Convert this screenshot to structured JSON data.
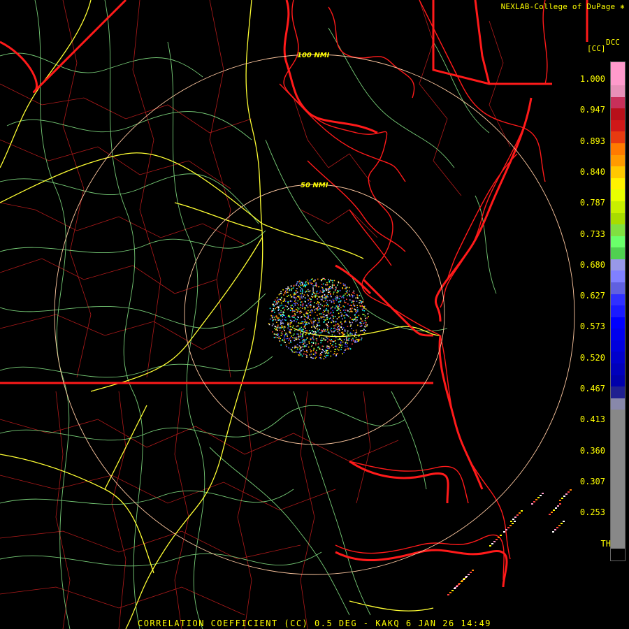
{
  "credit": "NEXLAB-College of DuPage",
  "caption": "CORRELATION COEFFICIENT (CC) 0.5 DEG - KAKQ 6 JAN 26 14:49",
  "legend": {
    "product": "DCC",
    "unit": "[CC]",
    "ticks": [
      "1.000",
      "0.947",
      "0.893",
      "0.840",
      "0.787",
      "0.733",
      "0.680",
      "0.627",
      "0.573",
      "0.520",
      "0.467",
      "0.413",
      "0.360",
      "0.307",
      "0.253",
      "TH"
    ],
    "colors": [
      "#ff9acb",
      "#ff9acb",
      "#e890b8",
      "#c8305a",
      "#b8101a",
      "#d01818",
      "#e83a10",
      "#ff7a00",
      "#ff9a00",
      "#ffc800",
      "#fff200",
      "#e8ff00",
      "#c8f000",
      "#a8dc00",
      "#80e040",
      "#6aff6a",
      "#50d050",
      "#9898e8",
      "#8080ff",
      "#6060e0",
      "#3030ff",
      "#1a1aff",
      "#0000ff",
      "#0000ee",
      "#0000dd",
      "#0000cc",
      "#0000bb",
      "#0000aa",
      "#202090",
      "#8888aa",
      "#888888",
      "#888888",
      "#888888",
      "#888888",
      "#888888",
      "#888888",
      "#888888",
      "#888888",
      "#888888",
      "#888888",
      "#888888",
      "#888888",
      "#000000"
    ]
  },
  "range_rings": [
    "50 NMI",
    "100 NMI"
  ],
  "colors": {
    "background": "#000000",
    "state_borders": "#ff1a1a",
    "county_lines": "#cc1f1f",
    "roads": "#8af08a",
    "interstates": "#ffff33",
    "range_rings": "#ffc8a0"
  }
}
